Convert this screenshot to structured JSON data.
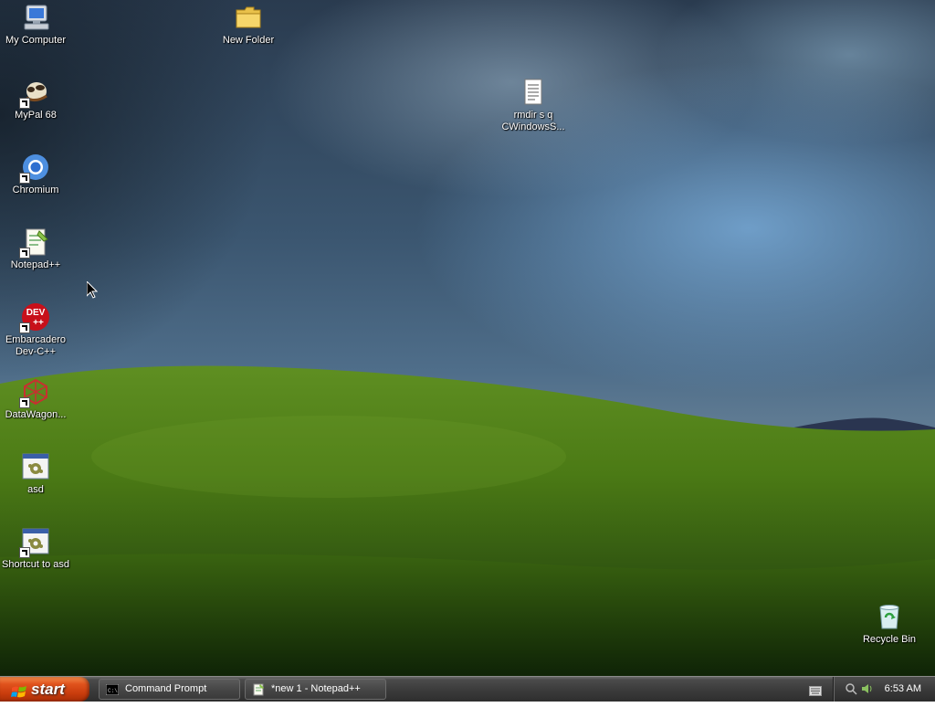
{
  "desktop": {
    "icons": [
      {
        "id": "my-computer",
        "label": "My Computer",
        "icon": "my-computer-icon"
      },
      {
        "id": "mypal",
        "label": "MyPal 68",
        "icon": "mypal-icon",
        "shortcut": true
      },
      {
        "id": "chromium",
        "label": "Chromium",
        "icon": "chromium-icon",
        "shortcut": true
      },
      {
        "id": "notepadpp",
        "label": "Notepad++",
        "icon": "notepadpp-icon",
        "shortcut": true
      },
      {
        "id": "devcpp",
        "label": "Embarcadero\nDev-C++",
        "icon": "devcpp-icon",
        "shortcut": true
      },
      {
        "id": "datawagon",
        "label": "DataWagon...",
        "icon": "datawagon-icon",
        "shortcut": true
      },
      {
        "id": "asd",
        "label": "asd",
        "icon": "batch-file-icon"
      },
      {
        "id": "shortcut-asd",
        "label": "Shortcut to asd",
        "icon": "batch-file-icon",
        "shortcut": true
      },
      {
        "id": "new-folder",
        "label": "New Folder",
        "icon": "folder-icon"
      },
      {
        "id": "rmdir-file",
        "label": "rmdir s q\nCWindowsS...",
        "icon": "text-file-icon"
      },
      {
        "id": "recycle-bin",
        "label": "Recycle Bin",
        "icon": "recycle-bin-icon"
      }
    ],
    "devcpp_badge": "DEV"
  },
  "taskbar": {
    "start_label": "start",
    "tasks": [
      {
        "label": "Command Prompt",
        "icon": "command-prompt-icon"
      },
      {
        "label": "*new 1 - Notepad++",
        "icon": "notepadpp-icon"
      }
    ],
    "clock": "6:53 AM",
    "cmd_badge": "C:\\"
  },
  "colors": {
    "start_orange": "#e0521c",
    "taskbar_gray": "#3c3c3c",
    "hill_green": "#4a7a18"
  }
}
